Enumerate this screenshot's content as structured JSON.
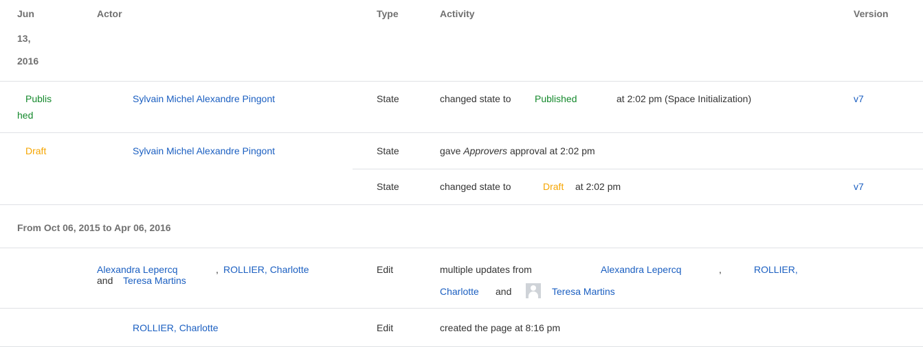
{
  "header": {
    "date_line1": "Jun",
    "date_line2": "13,",
    "date_line3": "2016",
    "actor": "Actor",
    "type": "Type",
    "activity": "Activity",
    "version": "Version"
  },
  "rows": [
    {
      "state_line1": "Publis",
      "state_line2": "hed",
      "actor": "Sylvain Michel Alexandre Pingont",
      "type": "State",
      "activity_prefix": "changed state to",
      "activity_state": "Published",
      "activity_suffix": "at 2:02 pm (Space Initialization)",
      "version": "v7"
    },
    {
      "state": "Draft",
      "actor": "Sylvain Michel Alexandre Pingont",
      "type": "State",
      "activity_prefix": "gave",
      "activity_em": "Approvers",
      "activity_suffix": "approval at 2:02 pm"
    },
    {
      "type": "State",
      "activity_prefix": "changed state to",
      "activity_state": "Draft",
      "activity_suffix": "at 2:02 pm",
      "version": "v7"
    }
  ],
  "period": {
    "label": "From Oct 06, 2015 to Apr 06, 2016"
  },
  "edits": [
    {
      "actor1": "Alexandra Lepercq",
      "actor_sep": ",",
      "actor2": "ROLLIER, Charlotte",
      "actor_and": "and",
      "actor3": "Teresa Martins",
      "type": "Edit",
      "activity_prefix": "multiple updates from",
      "activity_user1": "Alexandra Lepercq",
      "activity_sep": ",",
      "activity_user2_part1": "ROLLIER,",
      "activity_user2_part2": "Charlotte",
      "activity_and": "and",
      "activity_user3": "Teresa Martins",
      "avatar_icon": "user-avatar-icon"
    },
    {
      "actor": "ROLLIER, Charlotte",
      "type": "Edit",
      "activity": "created the page at 8:16 pm"
    }
  ],
  "colors": {
    "link": "#1b5fc1",
    "published": "#14892c",
    "draft": "#f6a500",
    "header_text": "#707070",
    "divider": "#dfe1e5"
  }
}
